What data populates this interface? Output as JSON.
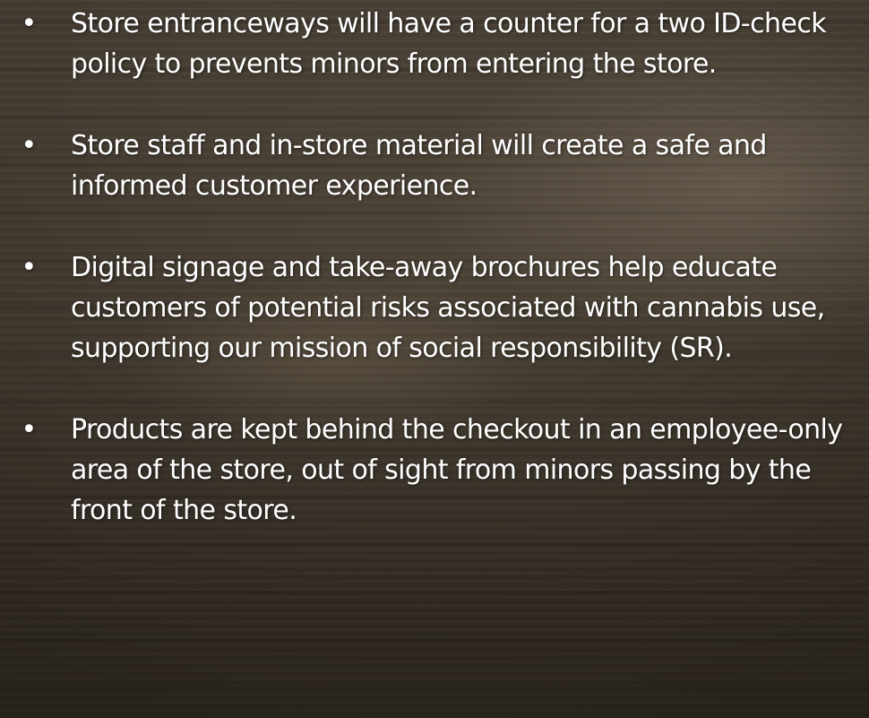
{
  "slide": {
    "bullet_symbol": "•",
    "bullets": [
      "Store entranceways will have a counter for a two ID-check policy to prevents minors from entering the store.",
      "Store staff and in-store material will create a safe and informed customer experience.",
      "Digital signage and take-away brochures help educate customers of potential risks associated with cannabis use, supporting our mission of social responsibility (SR).",
      "Products are kept behind the checkout in an employee-only area of the store, out of sight from minors passing by the front of the store."
    ],
    "colors": {
      "text": "#ffffff",
      "background_wood": "#4c4337"
    }
  }
}
